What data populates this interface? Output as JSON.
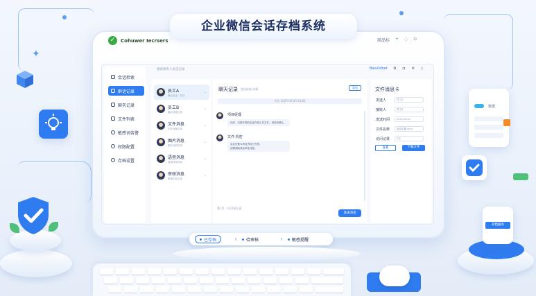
{
  "window": {
    "title": "企业微信会话存档系统"
  },
  "brand": {
    "logo_text": "Cohuwer Iecrsers"
  },
  "topbar": {
    "items": [
      "商品标",
      "+",
      "◌",
      "⊙"
    ]
  },
  "sidebar": {
    "items": [
      {
        "label": "会话检索",
        "icon": "search-icon",
        "active": false
      },
      {
        "label": "群话记录",
        "icon": "home-icon",
        "active": true
      },
      {
        "label": "聊天记录",
        "icon": "document-icon",
        "active": false
      },
      {
        "label": "文件列表",
        "icon": "file-icon",
        "active": false
      },
      {
        "label": "敏感词告警",
        "icon": "user-icon",
        "active": false
      },
      {
        "label": "权限配置",
        "icon": "gear-icon",
        "active": false
      },
      {
        "label": "存档设置",
        "icon": "settings-icon",
        "active": false
      }
    ]
  },
  "header": {
    "search_placeholder": "搜索联系人会话记录",
    "account": "Baiu0dbet"
  },
  "contacts": {
    "items": [
      {
        "name": "员工A",
        "sub": "最近会话 · 在线",
        "active": true
      },
      {
        "name": "员工B",
        "sub": "最近消息记录",
        "active": false
      },
      {
        "name": "文件消息",
        "sub": "文件传输记录",
        "active": false
      },
      {
        "name": "图片消息",
        "sub": "图片存档内容",
        "active": false
      },
      {
        "name": "语音消息",
        "sub": "语音存档内容",
        "active": false
      },
      {
        "name": "审核消息",
        "sub": "审核内容记录",
        "active": false
      }
    ]
  },
  "chat": {
    "title": "聊天记录",
    "subtitle": "会话存档·详情",
    "header_button": "导出",
    "date_divider": "今天 2023-06-03 10:05",
    "messages": [
      {
        "sender": "项目经理",
        "lines": [
          "你好，这是本周的会话存档汇总文件，请查收确认。"
        ]
      },
      {
        "sender": "文件·机密",
        "lines": [
          "会议纪要与项目资料已归档，",
          "如需调阅请走审批流程。"
        ]
      }
    ],
    "footer": "第1页 · 共23条记录",
    "send_button": "发送消息"
  },
  "details": {
    "title": "文件消息卡",
    "fields": [
      {
        "label": "发送人",
        "value": "员工A"
      },
      {
        "label": "接收人",
        "value": "员工B"
      },
      {
        "label": "发送时间",
        "value": "2023-06-03"
      },
      {
        "label": "文件名称",
        "value": "会议纪要.docx"
      },
      {
        "label": "访问记录",
        "value": "3次"
      }
    ],
    "buttons": {
      "secondary": "查看",
      "primary": "下载文件"
    }
  },
  "status_bar": {
    "items": [
      {
        "label": "已存档",
        "active": true
      },
      {
        "label": "待审核",
        "active": false
      },
      {
        "label": "敏感提醒",
        "active": false
      }
    ]
  },
  "decor": {
    "data_card_label": "数据",
    "right_device_label": "存档服务"
  },
  "colors": {
    "accent": "#2f7bf0",
    "brand_green": "#3aa845",
    "title": "#1c2f63"
  }
}
